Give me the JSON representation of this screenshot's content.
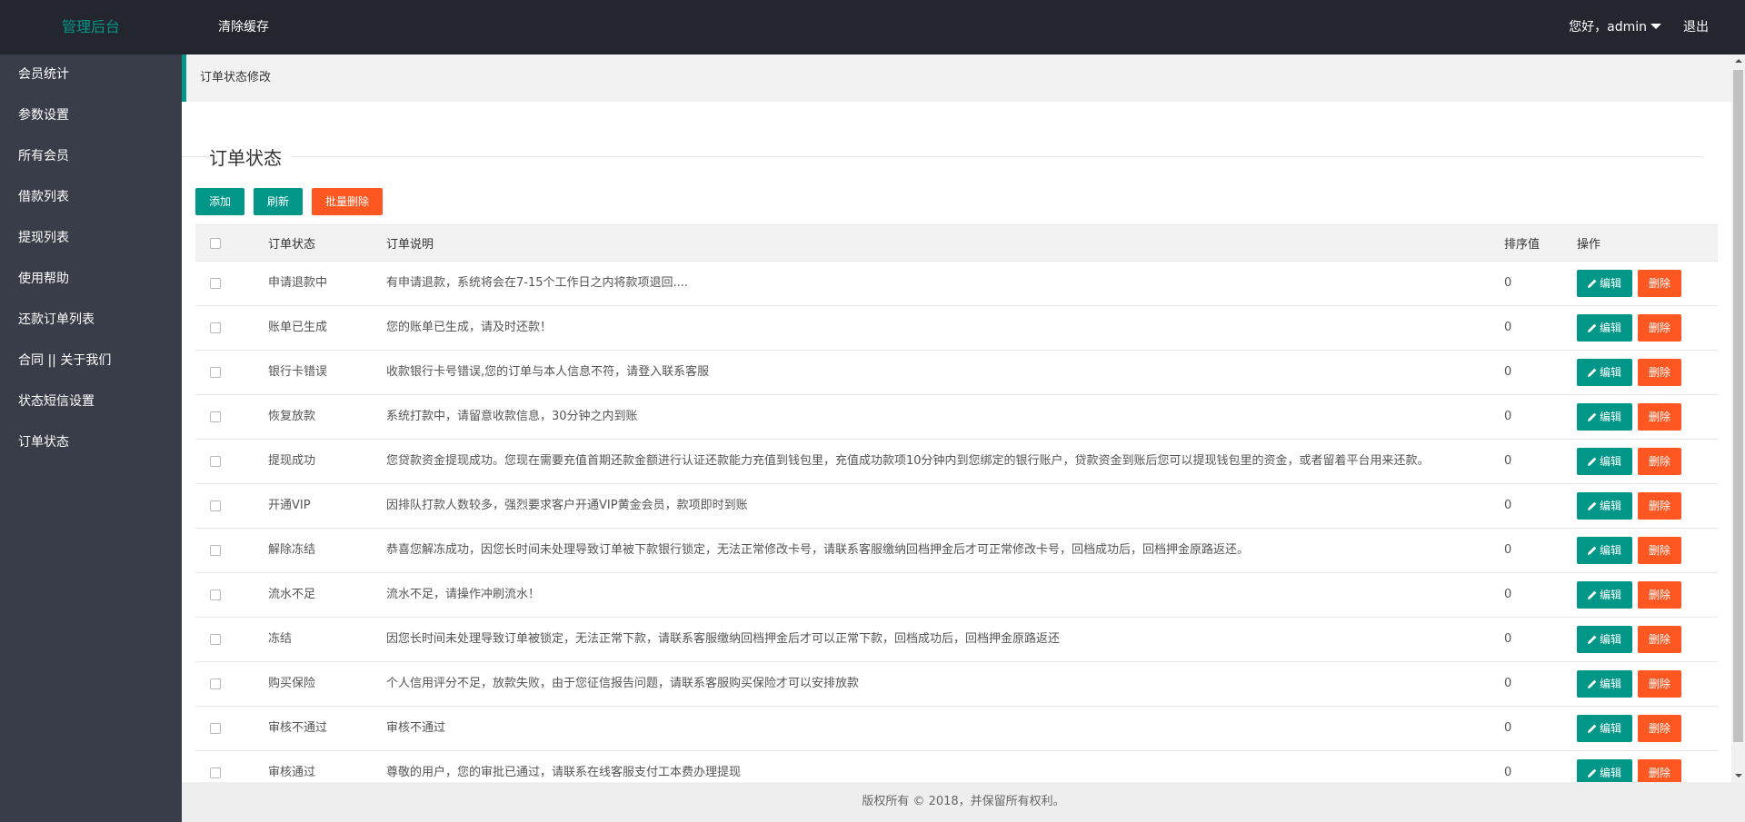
{
  "header": {
    "logo": "管理后台",
    "clear_cache": "清除缓存",
    "user_greeting": "您好，admin",
    "logout": "退出"
  },
  "sidebar": {
    "items": [
      {
        "label": "会员统计"
      },
      {
        "label": "参数设置"
      },
      {
        "label": "所有会员"
      },
      {
        "label": "借款列表"
      },
      {
        "label": "提现列表"
      },
      {
        "label": "使用帮助"
      },
      {
        "label": "还款订单列表"
      },
      {
        "label": "合同 || 关于我们"
      },
      {
        "label": "状态短信设置"
      },
      {
        "label": "订单状态"
      }
    ]
  },
  "breadcrumb": "订单状态修改",
  "section_title": "订单状态",
  "toolbar": {
    "add": "添加",
    "refresh": "刷新",
    "batch_delete": "批量删除"
  },
  "table": {
    "headers": {
      "status": "订单状态",
      "desc": "订单说明",
      "sort": "排序值",
      "ops": "操作"
    },
    "edit_label": "编辑",
    "delete_label": "删除",
    "rows": [
      {
        "status": "申请退款中",
        "desc": "有申请退款，系统将会在7-15个工作日之内将款项退回....",
        "sort": "0"
      },
      {
        "status": "账单已生成",
        "desc": "您的账单已生成，请及时还款！",
        "sort": "0"
      },
      {
        "status": "银行卡错误",
        "desc": "收款银行卡号错误,您的订单与本人信息不符，请登入联系客服",
        "sort": "0"
      },
      {
        "status": "恢复放款",
        "desc": "系统打款中，请留意收款信息，30分钟之内到账",
        "sort": "0"
      },
      {
        "status": "提现成功",
        "desc": "您贷款资金提现成功。您现在需要充值首期还款金额进行认证还款能力充值到钱包里，充值成功款项10分钟内到您绑定的银行账户，贷款资金到账后您可以提现钱包里的资金，或者留着平台用来还款。",
        "sort": "0"
      },
      {
        "status": "开通VIP",
        "desc": "因排队打款人数较多，强烈要求客户开通VIP黄金会员，款项即时到账",
        "sort": "0"
      },
      {
        "status": "解除冻结",
        "desc": "恭喜您解冻成功，因您长时间未处理导致订单被下款银行锁定，无法正常修改卡号，请联系客服缴纳回档押金后才可正常修改卡号，回档成功后，回档押金原路返还。",
        "sort": "0"
      },
      {
        "status": "流水不足",
        "desc": "流水不足，请操作冲刷流水！",
        "sort": "0"
      },
      {
        "status": "冻结",
        "desc": "因您长时间未处理导致订单被锁定，无法正常下款，请联系客服缴纳回档押金后才可以正常下款，回档成功后，回档押金原路返还",
        "sort": "0"
      },
      {
        "status": "购买保险",
        "desc": "个人信用评分不足，放款失败，由于您征信报告问题，请联系客服购买保险才可以安排放款",
        "sort": "0"
      },
      {
        "status": "审核不通过",
        "desc": "审核不通过",
        "sort": "0"
      },
      {
        "status": "审核通过",
        "desc": "尊敬的用户，您的审批已通过，请联系在线客服支付工本费办理提现",
        "sort": "0"
      }
    ]
  },
  "footer": "版权所有 © 2018，并保留所有权利。",
  "colors": {
    "accent": "#009688",
    "danger": "#ff5722",
    "header_bg": "#23262e",
    "sidebar_bg": "#393d49"
  }
}
